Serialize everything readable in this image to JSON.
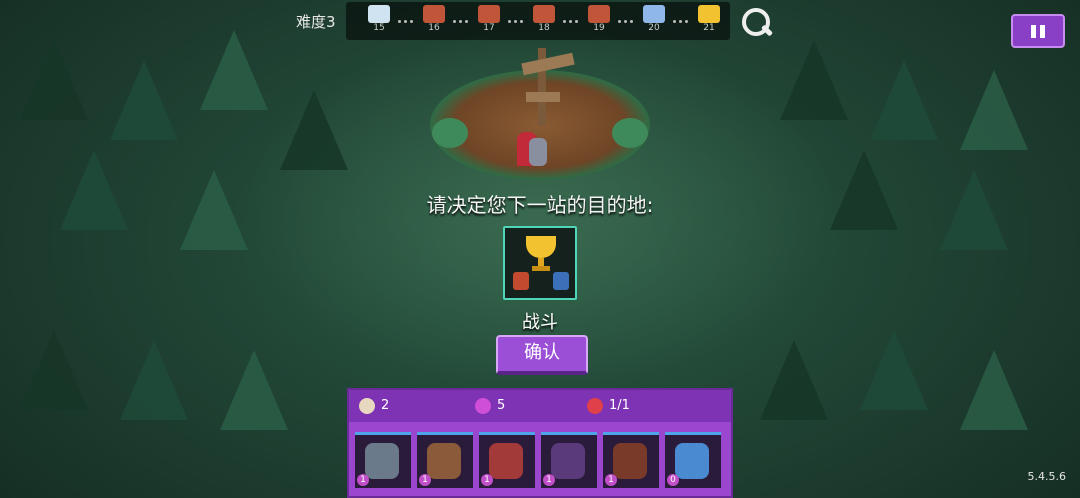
{
  "top_bar": {
    "difficulty_label": "难度3",
    "stages": [
      {
        "num": "15",
        "icon": "wave-boss-icon",
        "color": "#cfe3f0"
      },
      {
        "num": "16",
        "icon": "battle-icon",
        "color": "#c0553a"
      },
      {
        "num": "17",
        "icon": "battle-icon",
        "color": "#c0553a"
      },
      {
        "num": "18",
        "icon": "battle-icon",
        "color": "#c0553a"
      },
      {
        "num": "19",
        "icon": "battle-icon",
        "color": "#c0553a"
      },
      {
        "num": "20",
        "icon": "ice-boss-icon",
        "color": "#8fb8e8"
      },
      {
        "num": "21",
        "icon": "trophy-icon",
        "color": "#f2c230"
      }
    ]
  },
  "main": {
    "prompt": "请决定您下一站的目的地:",
    "node_label": "战斗",
    "confirm_label": "确认"
  },
  "resources": {
    "bag": "2",
    "gems": "5",
    "lives": "1/1"
  },
  "units": [
    {
      "level": "1",
      "color": "#6a7a8a"
    },
    {
      "level": "1",
      "color": "#8a5a3a"
    },
    {
      "level": "1",
      "color": "#a33a3a"
    },
    {
      "level": "1",
      "color": "#5a3a7a"
    },
    {
      "level": "1",
      "color": "#7a3a2a"
    },
    {
      "level": "0",
      "color": "#4a8ad0"
    }
  ],
  "version": "5.4.5.6",
  "colors": {
    "accent_purple": "#9a4fd6",
    "node_border": "#4fd6b8"
  }
}
